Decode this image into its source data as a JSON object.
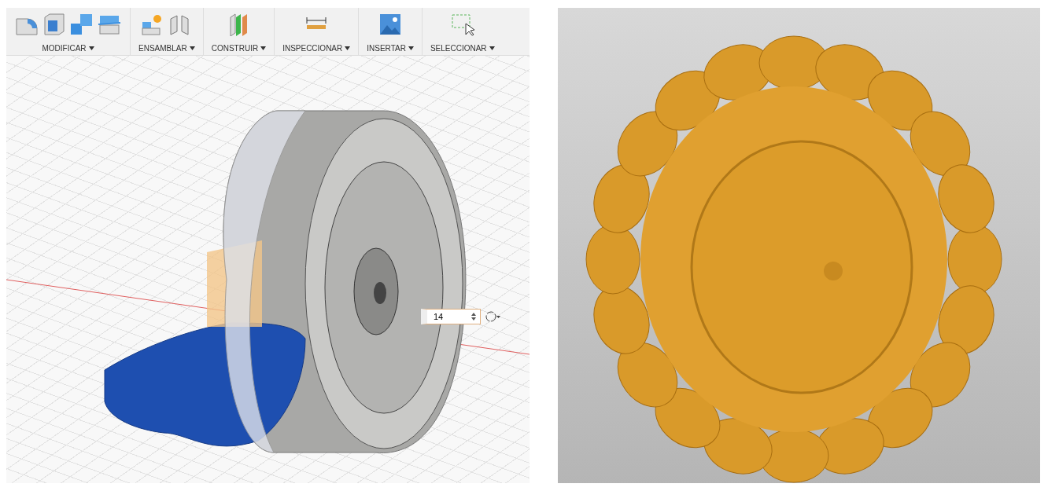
{
  "toolbar": {
    "groups": [
      {
        "label": "MODIFICAR"
      },
      {
        "label": "ENSAMBLAR"
      },
      {
        "label": "CONSTRUIR"
      },
      {
        "label": "INSPECCIONAR"
      },
      {
        "label": "INSERTAR"
      },
      {
        "label": "SELECCIONAR"
      }
    ]
  },
  "viewport": {
    "dimension_input": {
      "value": "14"
    }
  }
}
